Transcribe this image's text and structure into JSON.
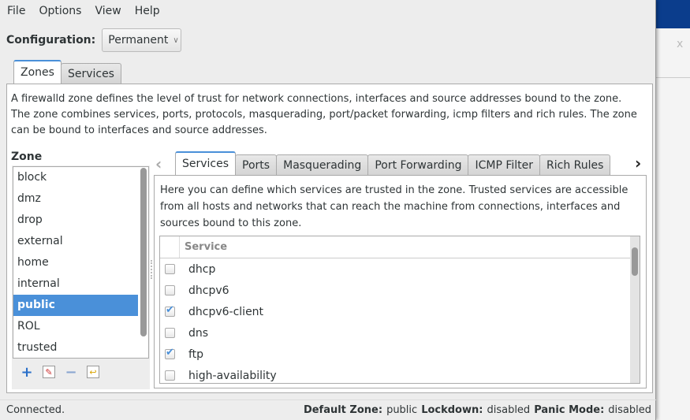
{
  "menu": [
    "File",
    "Options",
    "View",
    "Help"
  ],
  "configuration": {
    "label": "Configuration:",
    "value": "Permanent"
  },
  "main_tabs": [
    {
      "label": "Zones",
      "active": true
    },
    {
      "label": "Services",
      "active": false
    }
  ],
  "zones_description": "A firewalld zone defines the level of trust for network connections, interfaces and source addresses bound to the zone. The zone combines services, ports, protocols, masquerading, port/packet forwarding, icmp filters and rich rules. The zone can be bound to interfaces and source addresses.",
  "zone_panel": {
    "label": "Zone",
    "items": [
      "block",
      "dmz",
      "drop",
      "external",
      "home",
      "internal",
      "public",
      "ROL",
      "trusted"
    ],
    "selected": "public",
    "tools": [
      "add-icon",
      "edit-icon",
      "remove-icon",
      "load-defaults-icon"
    ]
  },
  "zone_tabs": [
    {
      "label": "Services",
      "active": true
    },
    {
      "label": "Ports"
    },
    {
      "label": "Masquerading"
    },
    {
      "label": "Port Forwarding"
    },
    {
      "label": "ICMP Filter"
    },
    {
      "label": "Rich Rules"
    }
  ],
  "services_description": "Here you can define which services are trusted in the zone. Trusted services are accessible from all hosts and networks that can reach the machine from connections, interfaces and sources bound to this zone.",
  "services_table": {
    "header": "Service",
    "rows": [
      {
        "name": "dhcp",
        "checked": false
      },
      {
        "name": "dhcpv6",
        "checked": false
      },
      {
        "name": "dhcpv6-client",
        "checked": true
      },
      {
        "name": "dns",
        "checked": false
      },
      {
        "name": "ftp",
        "checked": true
      },
      {
        "name": "high-availability",
        "checked": false
      }
    ]
  },
  "status": {
    "left": "Connected.",
    "default_zone_label": "Default Zone:",
    "default_zone": "public",
    "lockdown_label": "Lockdown:",
    "lockdown": "disabled",
    "panic_label": "Panic Mode:",
    "panic": "disabled"
  },
  "colors": {
    "accent": "#4a90d9",
    "desktop_bar": "#0b3d8c"
  }
}
